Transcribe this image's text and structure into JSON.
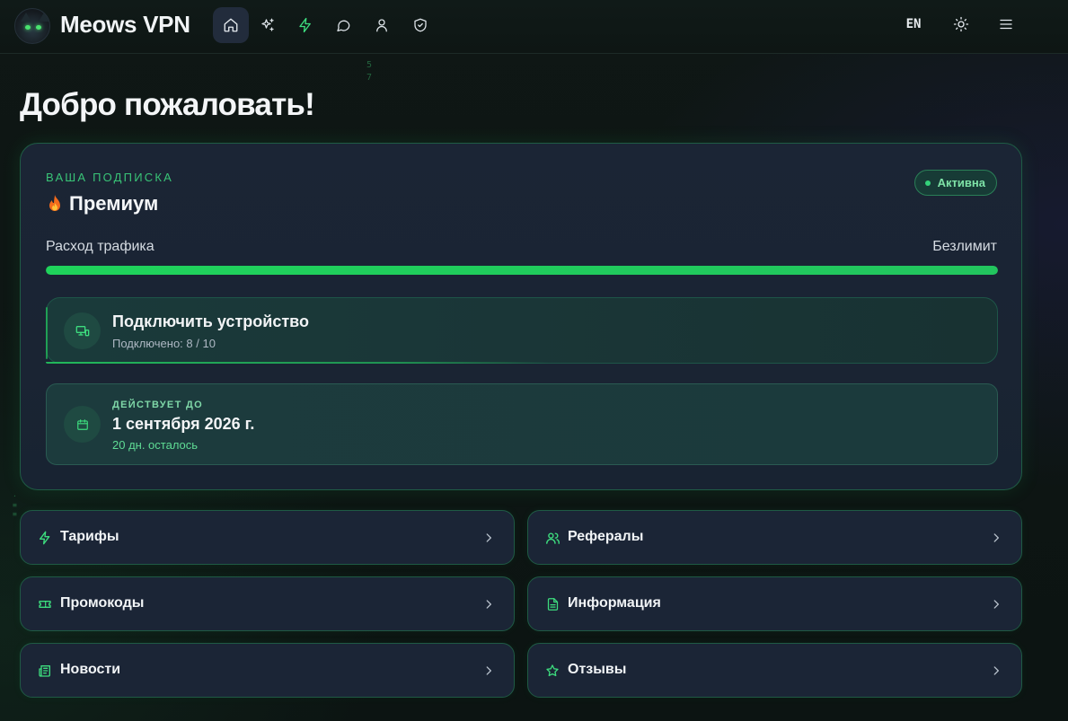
{
  "header": {
    "brand": "Meows VPN",
    "nav": [
      {
        "icon": "home-icon",
        "active": true
      },
      {
        "icon": "sparkles-icon",
        "active": false
      },
      {
        "icon": "lightning-icon",
        "active": false
      },
      {
        "icon": "chat-bubble-icon",
        "active": false
      },
      {
        "icon": "user-icon",
        "active": false
      },
      {
        "icon": "shield-check-icon",
        "active": false
      }
    ],
    "language": "EN"
  },
  "page_title": "Добро пожаловать!",
  "subscription": {
    "label": "ВАША ПОДПИСКА",
    "plan": "Премиум",
    "status": "Активна",
    "traffic_label": "Расход трафика",
    "traffic_value": "Безлимит",
    "traffic_fill_fraction": 1.0,
    "device": {
      "title": "Подключить устройство",
      "subtitle": "Подключено: 8 / 10"
    },
    "validity": {
      "label": "ДЕЙСТВУЕТ ДО",
      "date": "1 сентября 2026 г.",
      "remaining": "20 дн. осталось"
    }
  },
  "menu": [
    {
      "label": "Тарифы",
      "icon": "lightning-icon"
    },
    {
      "label": "Рефералы",
      "icon": "users-icon"
    },
    {
      "label": "Промокоды",
      "icon": "ticket-icon"
    },
    {
      "label": "Информация",
      "icon": "document-icon"
    },
    {
      "label": "Новости",
      "icon": "newspaper-icon"
    },
    {
      "label": "Отзывы",
      "icon": "star-icon"
    }
  ],
  "colors": {
    "accent": "#22c55e",
    "background": "#0d1413",
    "card": "#1b2536"
  }
}
